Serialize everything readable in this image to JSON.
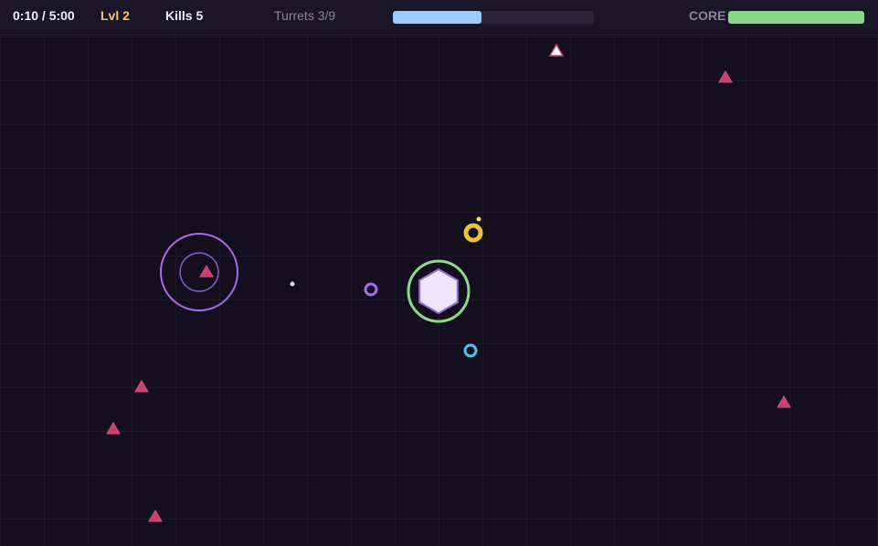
{
  "hud": {
    "time": "0:10 / 5:00",
    "level": "Lvl 2",
    "kills": "Kills 5",
    "turrets": "Turrets 3/9",
    "wave_progress": 0.44,
    "core_label": "CORE",
    "core_health": 1.0
  },
  "colors": {
    "background": "#130f1f",
    "level_text": "#f2c66b",
    "wave_bar": "#9ecbff",
    "core_bar": "#8ad68a",
    "enemy": "#c8406e",
    "enemy_highlight": "#ffffff",
    "core_fill": "#ece6ff",
    "core_stroke": "#9b6bd6",
    "core_ring": "#8fd98f",
    "turret_purple": "#a66bf0",
    "turret_yellow": "#e6c43a",
    "turret_cyan": "#4cc6e8",
    "projectile": "#e7d4ff"
  },
  "icons": {
    "enemy": "triangle-icon",
    "core": "hexagon-icon",
    "turret": "ring-turret-icon",
    "blast": "shockwave-ring-icon"
  }
}
